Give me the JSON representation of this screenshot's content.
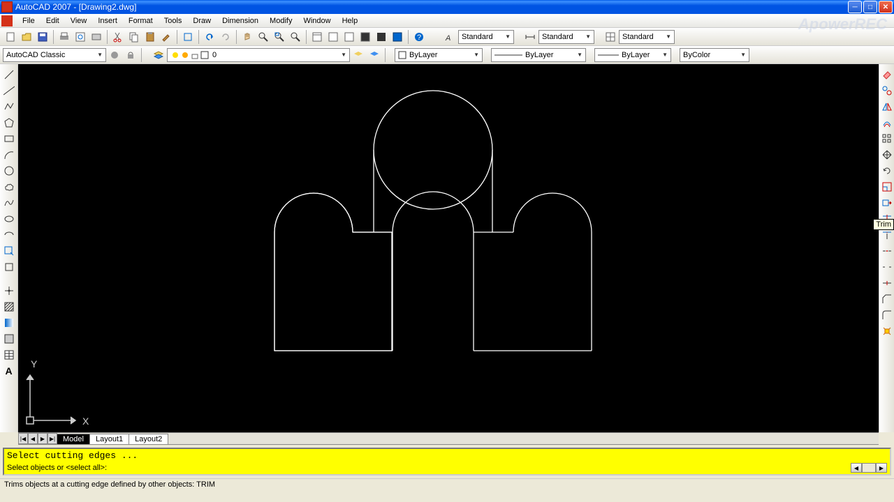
{
  "title": "AutoCAD 2007 - [Drawing2.dwg]",
  "watermark": "ApowerREC",
  "menu": [
    "File",
    "Edit",
    "View",
    "Insert",
    "Format",
    "Tools",
    "Draw",
    "Dimension",
    "Modify",
    "Window",
    "Help"
  ],
  "workspace": "AutoCAD Classic",
  "layer_field": "0",
  "style_combos": {
    "text_style": "Standard",
    "dim_style": "Standard",
    "table_style": "Standard"
  },
  "props": {
    "color": "ByLayer",
    "linetype": "ByLayer",
    "lineweight": "ByLayer",
    "plotstyle": "ByColor"
  },
  "tabs": {
    "model": "Model",
    "layout1": "Layout1",
    "layout2": "Layout2"
  },
  "cmd": {
    "line1": "Select cutting edges ...",
    "line2": "Select objects or <select all>:"
  },
  "status": "Trims objects at a cutting edge defined by other objects: TRIM",
  "tooltip": "Trim",
  "axis": {
    "x": "X",
    "y": "Y"
  },
  "chart_data": {
    "type": "other"
  }
}
